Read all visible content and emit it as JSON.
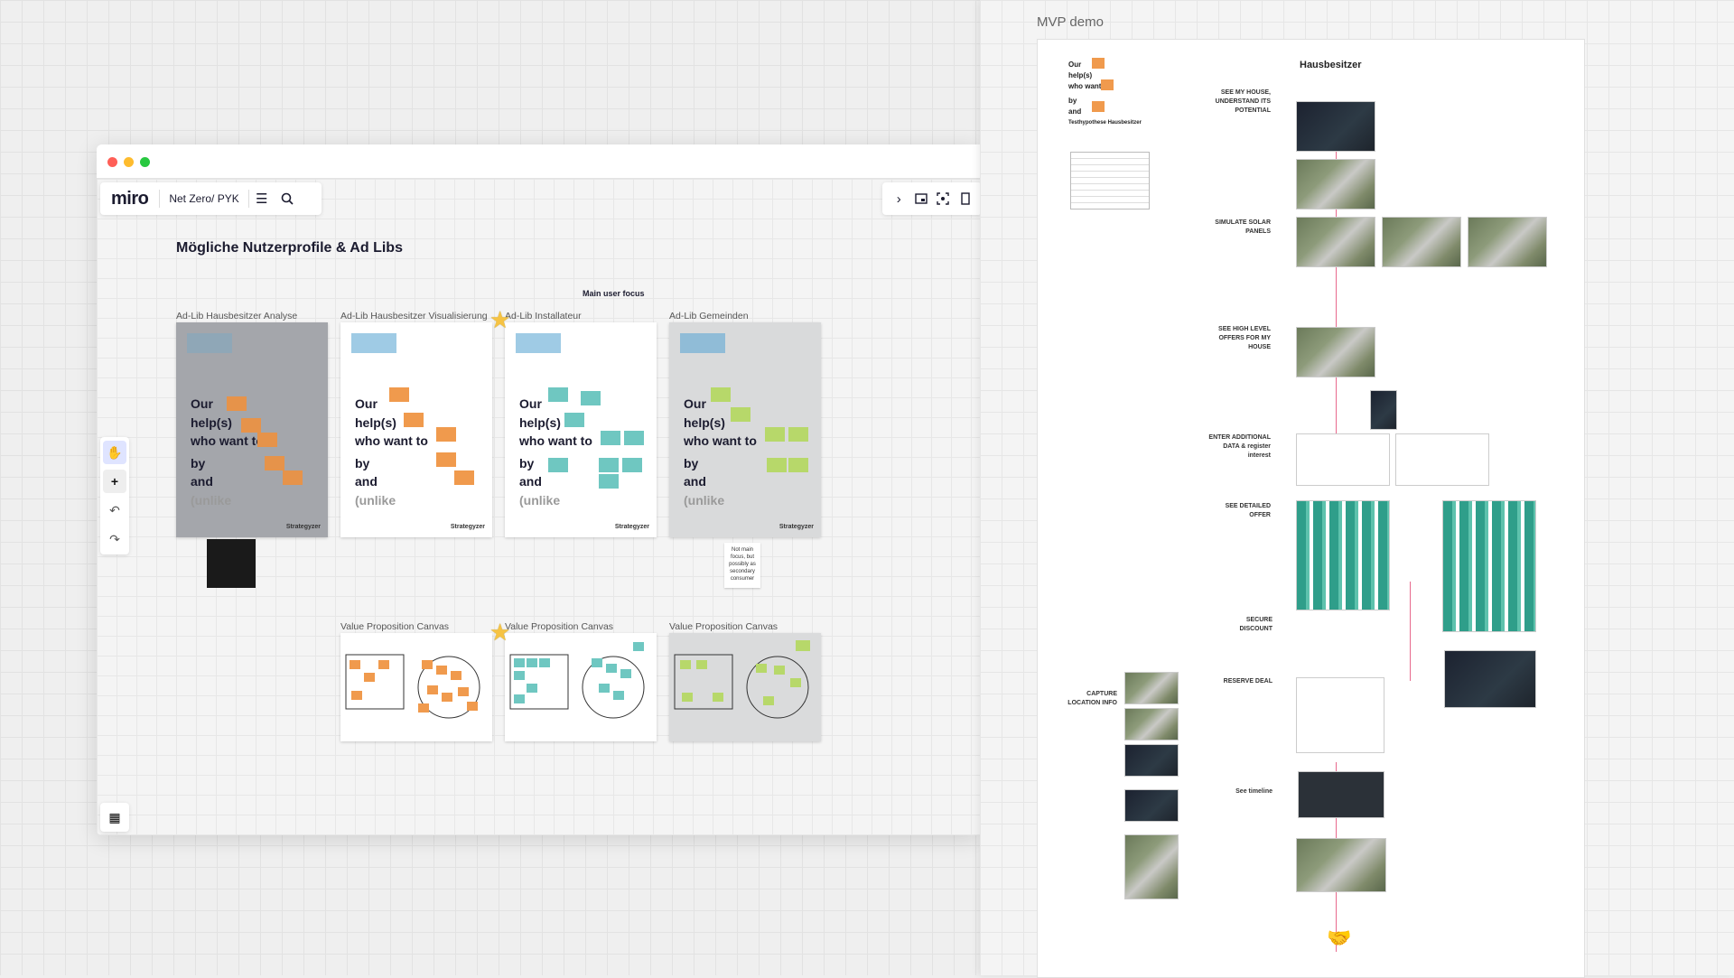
{
  "left_window": {
    "app_logo": "miro",
    "board_name": "Net Zero/ PYK",
    "heading": "Mögliche Nutzerprofile & Ad Libs",
    "main_focus_label": "Main user focus",
    "adlib_frames": [
      {
        "label": "Ad-Lib Hausbesitzer Analyse",
        "style": "gray",
        "note_color": "#e6934a"
      },
      {
        "label": "Ad-Lib Hausbesitzer Visualisierung",
        "style": "white",
        "note_color": "#f09a4d"
      },
      {
        "label": "Ad-Lib Installateur",
        "style": "white",
        "note_color": "#6fc7c1"
      },
      {
        "label": "Ad-Lib Gemeinden",
        "style": "lightgray",
        "note_color": "#b7d86a"
      }
    ],
    "adlib_text": {
      "line1": "Our",
      "line2": "help(s)",
      "line3": "who want to",
      "line4": "by",
      "line5": "and",
      "line6": "(unlike",
      "close": ")",
      "brand": "Strategyzer"
    },
    "black_note": "",
    "white_note": "Not main focus, but possibly as secondary consumer",
    "vpc_frames": [
      {
        "label": "Value Proposition Canvas",
        "note_color": "#f09a4d"
      },
      {
        "label": "Value Proposition Canvas",
        "note_color": "#6fc7c1"
      },
      {
        "label": "Value Proposition Canvas",
        "note_color": "#b7d86a"
      }
    ],
    "colors": {
      "accent": "#4255ff",
      "traffic_red": "#ff5f57",
      "traffic_yellow": "#febc2e",
      "traffic_green": "#28c840"
    },
    "icons": [
      "hand-icon",
      "plus-icon",
      "undo-icon",
      "redo-icon",
      "menu-icon",
      "search-icon",
      "chevron-right-icon",
      "frame-icon",
      "star-icon"
    ]
  },
  "right_panel": {
    "title": "MVP demo",
    "frame_title": "Hausbesitzer",
    "hypothesis_label": "Testhypothese Hausbesitzer",
    "steps": [
      "SEE MY HOUSE, UNDERSTAND ITS POTENTIAL",
      "SIMULATE SOLAR PANELS",
      "SEE HIGH LEVEL OFFERS FOR MY HOUSE",
      "ENTER ADDITIONAL DATA & register interest",
      "SEE DETAILED OFFER",
      "SECURE DISCOUNT",
      "RESERVE DEAL",
      "CAPTURE LOCATION INFO",
      "See timeline"
    ],
    "connector_color": "#e86a8d"
  }
}
